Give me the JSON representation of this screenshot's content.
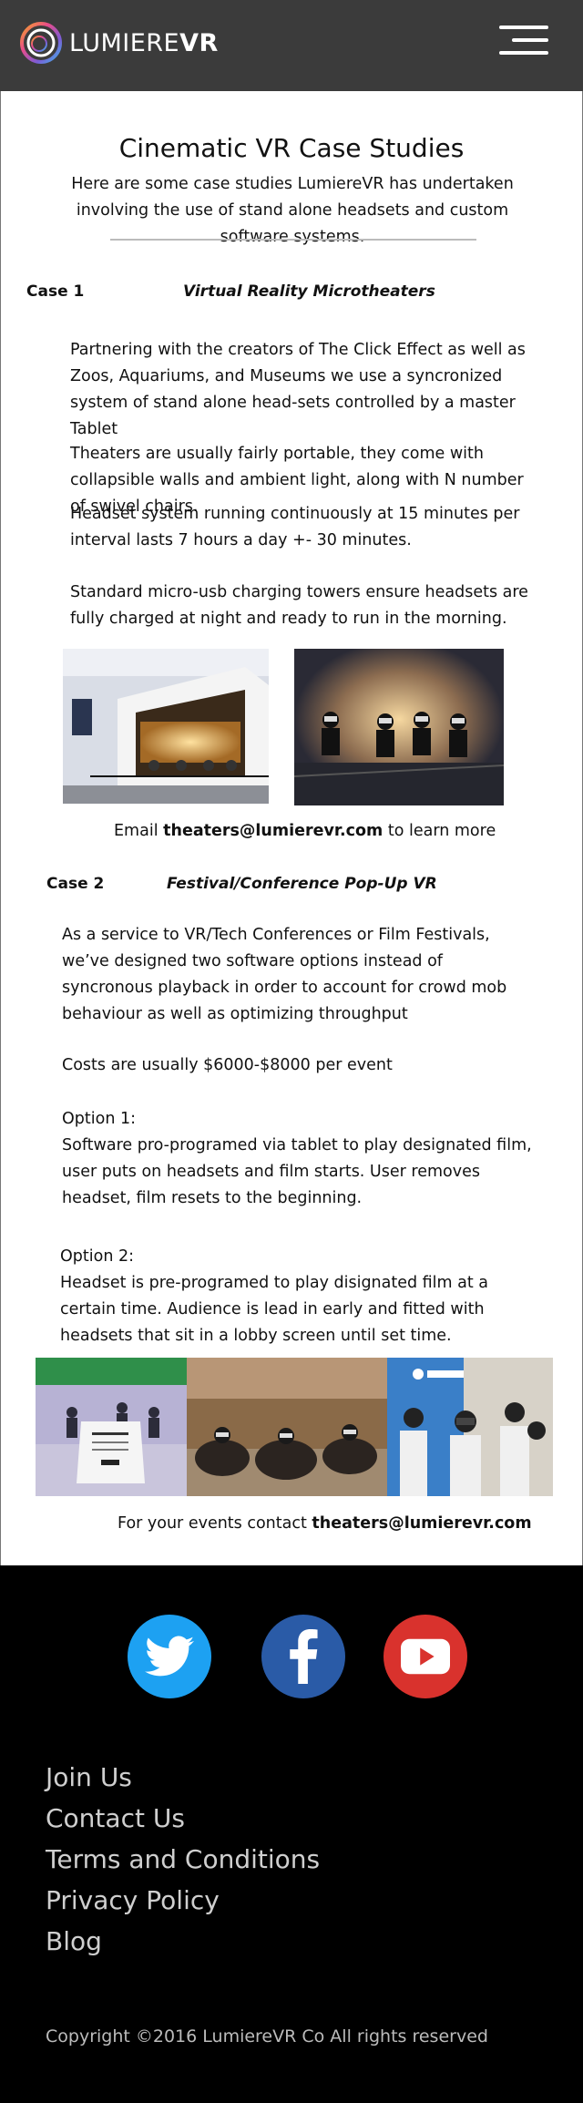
{
  "header": {
    "brand_light": "LUMIERE",
    "brand_bold": "VR"
  },
  "main": {
    "title": "Cinematic VR Case Studies",
    "intro": "Here are some case studies LumiereVR has undertaken involving the use of stand alone headsets and custom software systems."
  },
  "case1": {
    "label": "Case 1",
    "title": "Virtual Reality Microtheaters",
    "p1": "Partnering with the creators of The Click Effect as well as Zoos, Aquariums, and Museums we use a syncronized system of stand alone head-sets controlled by a master Tablet",
    "p2": "Theaters are usually fairly portable, they come with collapsible walls and ambient light, along with N number of swivel chairs.",
    "p3": "Headset system running continuously at 15 minutes per interval lasts 7 hours a day +- 30 minutes.",
    "p4": "Standard micro-usb charging towers ensure headsets are fully charged at night and ready to run in the morning.",
    "contact_prefix": "Email ",
    "contact_email": "theaters@lumierevr.com",
    "contact_suffix": " to learn more"
  },
  "case2": {
    "label": "Case 2",
    "title": "Festival/Conference Pop-Up VR",
    "p1": "As a service to VR/Tech Conferences or Film Festivals, we’ve designed two software options instead of syncronous playback in order to account for crowd mob behaviour as well as optimizing throughput",
    "p2": "Costs are usually $6000-$8000 per event",
    "p3": "Option 1:\nSoftware pro-programed via tablet to play designated film, user puts on headsets and film starts. User removes headset, film resets to the beginning.",
    "p4": "Option 2:\nHeadset is pre-programed to play disignated film at a certain time. Audience is lead in early and fitted with headsets that sit in a lobby screen until set time.",
    "contact_prefix": "For your events contact ",
    "contact_email": "theaters@lumierevr.com"
  },
  "footer": {
    "links": [
      "Join Us",
      "Contact Us",
      "Terms and Conditions",
      "Privacy Policy",
      "Blog"
    ],
    "copyright": "Copyright ©2016 LumiereVR Co All rights reserved"
  },
  "colors": {
    "header_bg": "#3b3b3b",
    "twitter": "#1da1f2",
    "facebook": "#2a5ba7",
    "youtube": "#d9322d"
  },
  "icons": [
    "logo-ring-icon",
    "hamburger-menu-icon",
    "twitter-icon",
    "facebook-icon",
    "youtube-icon"
  ]
}
